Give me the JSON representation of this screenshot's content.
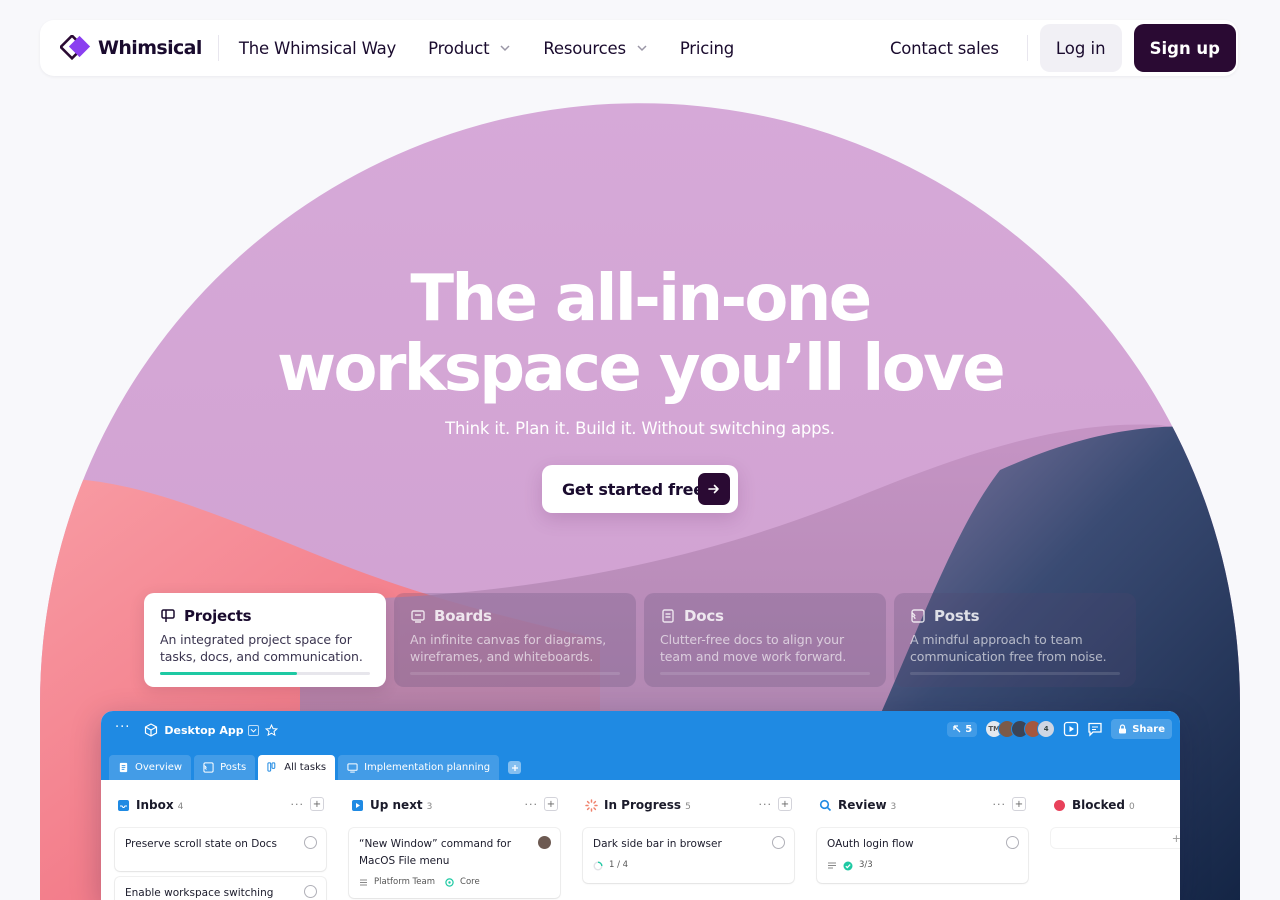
{
  "brand": {
    "name": "Whimsical"
  },
  "nav": {
    "links": [
      {
        "label": "The Whimsical Way"
      },
      {
        "label": "Product"
      },
      {
        "label": "Resources"
      },
      {
        "label": "Pricing"
      }
    ],
    "contact_label": "Contact sales",
    "login_label": "Log in",
    "signup_label": "Sign up"
  },
  "hero": {
    "headline_line1": "The all-in-one",
    "headline_line2": "workspace you’ll love",
    "subheadline": "Think it. Plan it. Build it. Without switching apps.",
    "cta_label": "Get started free"
  },
  "features": [
    {
      "title": "Projects",
      "description": "An integrated project space for tasks, docs, and communication.",
      "active": true,
      "progress": 0.65
    },
    {
      "title": "Boards",
      "description": "An infinite canvas for diagrams, wireframes, and whiteboards.",
      "active": false
    },
    {
      "title": "Docs",
      "description": "Clutter-free docs to align your team and move work forward.",
      "active": false
    },
    {
      "title": "Posts",
      "description": "A mindful approach to team communication free from noise.",
      "active": false
    }
  ],
  "app_preview": {
    "title": "Desktop App",
    "users_count": "5",
    "avatars": [
      "TM",
      "4"
    ],
    "share_label": "Share",
    "tabs": [
      {
        "label": "Overview"
      },
      {
        "label": "Posts"
      },
      {
        "label": "All tasks",
        "active": true
      },
      {
        "label": "Implementation planning"
      }
    ],
    "columns": [
      {
        "title": "Inbox",
        "count": "4",
        "cards": [
          {
            "title": "Preserve scroll state on Docs"
          },
          {
            "title": "Enable workspace switching"
          }
        ]
      },
      {
        "title": "Up next",
        "count": "3",
        "cards": [
          {
            "title": "“New Window” command for MacOS File menu",
            "tag1": "Platform Team",
            "tag2": "Core"
          }
        ]
      },
      {
        "title": "In Progress",
        "count": "5",
        "cards": [
          {
            "title": "Dark side bar in browser",
            "progress": "1 / 4"
          }
        ]
      },
      {
        "title": "Review",
        "count": "3",
        "cards": [
          {
            "title": "OAuth login flow",
            "progress": "3/3"
          }
        ]
      },
      {
        "title": "Blocked",
        "count": "0",
        "cards": []
      }
    ]
  },
  "colors": {
    "brand_dark": "#2a0a33",
    "hero_lilac": "#d7aad8",
    "accent_green": "#1ec9a3",
    "app_blue": "#1f8ae3"
  }
}
